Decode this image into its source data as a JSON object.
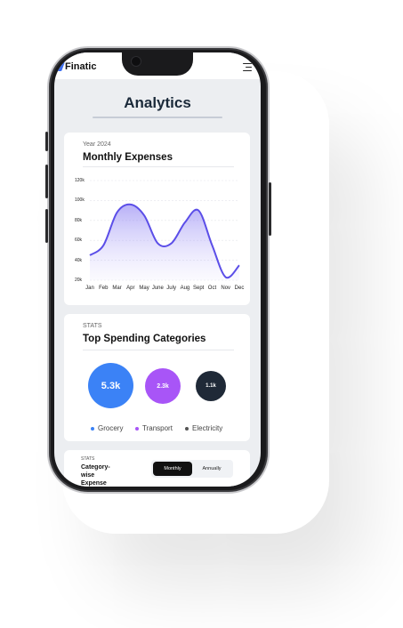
{
  "app": {
    "brand": "Finatic",
    "page_title": "Analytics"
  },
  "monthly_card": {
    "subtitle": "Year 2024",
    "title": "Monthly Expenses"
  },
  "stats_card": {
    "subtitle": "STATS",
    "title": "Top Spending Categories",
    "bubbles": [
      {
        "value": "5.3k",
        "color": "#3b82f6"
      },
      {
        "value": "2.3k",
        "color": "#a855f7"
      },
      {
        "value": "1.1k",
        "color": "#1f2937"
      }
    ],
    "legend": [
      {
        "label": "Grocery",
        "color": "#3b82f6"
      },
      {
        "label": "Transport",
        "color": "#a855f7"
      },
      {
        "label": "Electricity",
        "color": "#555555"
      }
    ]
  },
  "category_card": {
    "subtitle": "STATS",
    "title": "Category-wise Expense",
    "toggle": {
      "monthly": "Monthly",
      "annually": "Annually"
    }
  },
  "chart_data": {
    "type": "area",
    "categories": [
      "Jan",
      "Feb",
      "Mar",
      "Apr",
      "May",
      "June",
      "July",
      "Aug",
      "Sept",
      "Oct",
      "Nov",
      "Dec"
    ],
    "values": [
      45,
      55,
      88,
      96,
      85,
      57,
      57,
      78,
      90,
      55,
      23,
      35
    ],
    "y_ticks": [
      "120k",
      "100k",
      "80k",
      "60k",
      "40k",
      "20k"
    ],
    "ylim": [
      20,
      120
    ],
    "color": "#5b4ee8"
  }
}
